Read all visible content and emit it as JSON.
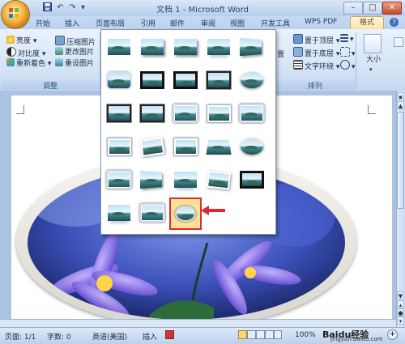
{
  "window": {
    "title": "文档 1 - Microsoft Word",
    "minimize": "–",
    "maximize": "□",
    "close": "✕"
  },
  "quick_access": {
    "save_icon": "save-icon",
    "undo_label": "↶",
    "redo_label": "↷",
    "more_label": "▾"
  },
  "tabs": [
    "开始",
    "插入",
    "页面布局",
    "引用",
    "邮件",
    "审阅",
    "视图",
    "开发工具",
    "WPS PDF"
  ],
  "active_tab": "格式",
  "ribbon": {
    "adjust_group": {
      "label": "调整",
      "brightness": "亮度",
      "contrast": "对比度",
      "recolor": "重新着色",
      "compress": "压缩图片",
      "change": "更改图片",
      "reset": "重设图片"
    },
    "arrange_group": {
      "label": "排列",
      "bring_front": "置于顶层",
      "send_back": "置于底层",
      "text_wrap": "文字环绕",
      "position_short": "置"
    },
    "size_group": {
      "label": "大小"
    }
  },
  "gallery": {
    "rows": 6,
    "columns": 5,
    "items_total": 28,
    "selected_style": "oval-soft-edge"
  },
  "status_bar": {
    "page": "页面: 1/1",
    "words": "字数: 0",
    "language": "英语(美国)",
    "insert_mode": "插入",
    "zoom": "100%",
    "watermark": "Baidu经验",
    "watermark_url": "jingyan.baidu.com"
  },
  "colors": {
    "ribbon_bg": "#d2e2f5",
    "active_tab": "#f8e2a8",
    "selection_outline": "#e02a2a",
    "selected_item_bg": "#fbe29a"
  }
}
